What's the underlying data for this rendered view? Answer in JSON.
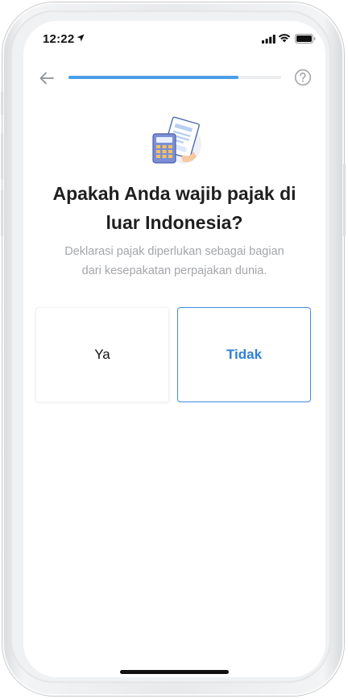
{
  "status_bar": {
    "time": "12:22",
    "icons": [
      "location-arrow-icon",
      "signal-icon",
      "wifi-icon",
      "battery-icon"
    ]
  },
  "nav": {
    "back_icon": "arrow-left-icon",
    "progress_fraction": 0.8,
    "help_icon": "question-circle-icon"
  },
  "illustration": "calculator-document-icon",
  "question": {
    "line1": "Apakah Anda wajib pajak di",
    "line2": "luar Indonesia?"
  },
  "description": {
    "line1": "Deklarasi pajak diperlukan sebagai bagian",
    "line2": "dari kesepakatan perpajakan dunia."
  },
  "options": {
    "yes_label": "Ya",
    "no_label": "Tidak",
    "selected": "Tidak"
  },
  "colors": {
    "accent": "#2f7fd9",
    "progress": "#4a9ee5",
    "title": "#1f1f1f",
    "muted": "#a4a6aa"
  }
}
